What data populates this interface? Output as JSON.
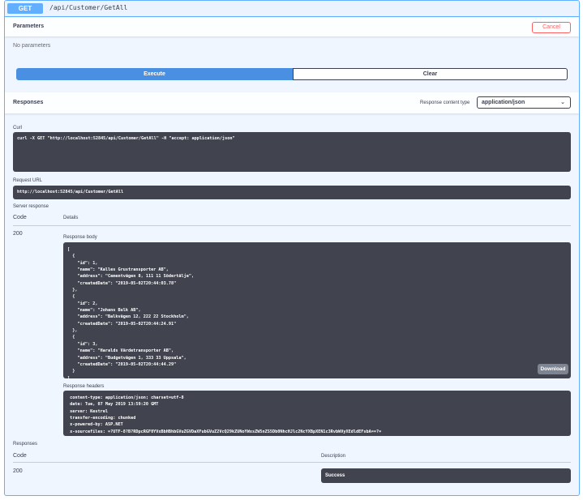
{
  "operation": {
    "method": "GET",
    "path": "/api/Customer/GetAll"
  },
  "parameters": {
    "title": "Parameters",
    "cancel_label": "Cancel",
    "empty_text": "No parameters"
  },
  "actions": {
    "execute_label": "Execute",
    "clear_label": "Clear"
  },
  "responses_header": {
    "title": "Responses",
    "content_type_label": "Response content type",
    "content_type_value": "application/json"
  },
  "curl": {
    "label": "Curl",
    "command": "curl -X GET \"http://localhost:52845/api/Customer/GetAll\" -H \"accept: application/json\""
  },
  "request_url": {
    "label": "Request URL",
    "value": "http://localhost:52845/api/Customer/GetAll"
  },
  "server_response": {
    "label": "Server response",
    "code_header": "Code",
    "details_header": "Details",
    "code": "200",
    "body_label": "Response body",
    "body": "[\n  {\n    \"id\": 1,\n    \"name\": \"Kalles Grustransporter AB\",\n    \"address\": \"Cementvägen 8, 111 11 Södertälje\",\n    \"createdDate\": \"2019-05-02T20:44:03.78\"\n  },\n  {\n    \"id\": 2,\n    \"name\": \"Johans Bulk AB\",\n    \"address\": \"Balkvägen 12, 222 22 Stockholm\",\n    \"createdDate\": \"2019-05-02T20:44:24.91\"\n  },\n  {\n    \"id\": 3,\n    \"name\": \"Haralds Värdetransporter AB\",\n    \"address\": \"Budgetvägen 1, 333 33 Uppsala\",\n    \"createdDate\": \"2019-05-02T20:44:44.29\"\n  }\n]",
    "download_label": "Download",
    "headers_label": "Response headers",
    "headers": " content-type: application/json; charset=utf-8\n date: Tue, 07 May 2019 13:59:20 GMT\n server: Kestrel\n transfer-encoding: chunked\n x-powered-by: ASP.NET\n x-sourcefiles: =?UTF-8?B?RDpcRGF0YVxBbHBhbGVuZGVDaXFubGVuZ2VcQ29kZUNoYWxsZW5nZS5Db0NhcHJlc2NcYXBpXEN1c3RvbWVyXEdldEFsbA==?="
  },
  "responses_table": {
    "label": "Responses",
    "code_header": "Code",
    "description_header": "Description",
    "code": "200",
    "description": "Success"
  }
}
